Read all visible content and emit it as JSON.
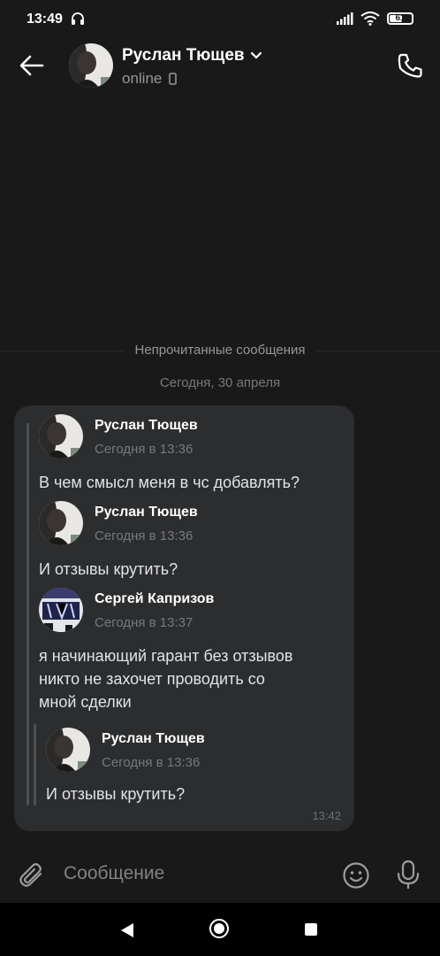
{
  "status_bar": {
    "time": "13:49",
    "battery": "61",
    "battery_level": 0.61
  },
  "header": {
    "name": "Руслан Тющев",
    "status": "online"
  },
  "chat": {
    "unread_divider": "Непрочитанные сообщения",
    "date": "Сегодня, 30 апреля",
    "bubble_time": "13:42",
    "forwarded": [
      {
        "name": "Руслан Тющев",
        "time": "Сегодня в 13:36",
        "text": "В чем смысл меня в чс добавлять?"
      },
      {
        "name": "Руслан Тющев",
        "time": "Сегодня в 13:36",
        "text": "И отзывы крутить?"
      },
      {
        "name": "Сергей Капризов",
        "time": "Сегодня в 13:37",
        "text": "я начинающий гарант без отзывов\nникто не захочет проводить со\nмной сделки"
      }
    ],
    "nested": {
      "name": "Руслан Тющев",
      "time": "Сегодня в 13:36",
      "text": "И отзывы крутить?"
    }
  },
  "composer": {
    "placeholder": "Сообщение"
  }
}
